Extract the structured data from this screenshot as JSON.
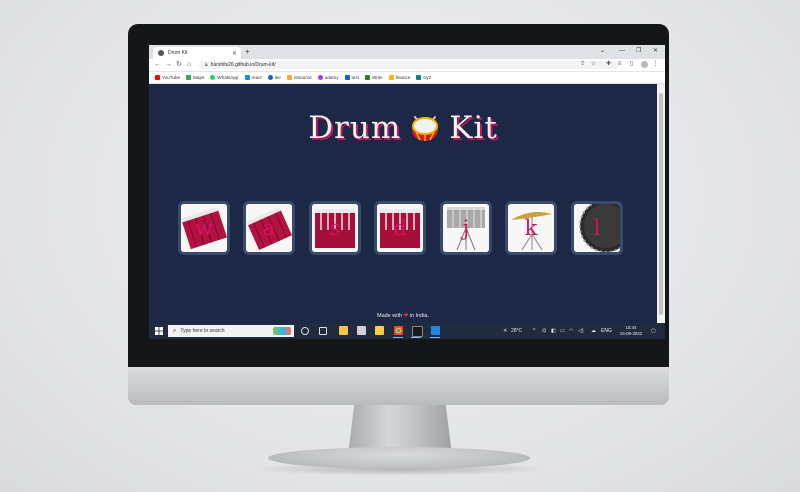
{
  "browser": {
    "tab_title": "Drum Kit",
    "new_tab": "+",
    "url": "harshits26.github.io/Drum-kit/",
    "bookmarks": [
      {
        "label": "YouTube",
        "color": "#ff0000"
      },
      {
        "label": "Maps",
        "color": "#34a853"
      },
      {
        "label": "WhatsApp",
        "color": "#25d366"
      },
      {
        "label": "react",
        "color": "#1e88e5"
      },
      {
        "label": "lee",
        "color": "#1565c0"
      },
      {
        "label": "resource",
        "color": "#f9a825"
      },
      {
        "label": "udemy",
        "color": "#a435f0"
      },
      {
        "label": "test",
        "color": "#1565c0"
      },
      {
        "label": "Write",
        "color": "#2e7d32"
      },
      {
        "label": "finance",
        "color": "#ffb300"
      },
      {
        "label": "try2",
        "color": "#00897b"
      }
    ]
  },
  "page": {
    "title_left": "Drum",
    "title_right": "Kit",
    "keys": [
      {
        "letter": "w",
        "sound": "tom-1"
      },
      {
        "letter": "a",
        "sound": "tom-2"
      },
      {
        "letter": "s",
        "sound": "tom-3"
      },
      {
        "letter": "d",
        "sound": "tom-4"
      },
      {
        "letter": "j",
        "sound": "snare"
      },
      {
        "letter": "k",
        "sound": "crash"
      },
      {
        "letter": "l",
        "sound": "kick-bass"
      }
    ],
    "footer_prefix": "Made with",
    "footer_heart": "❤",
    "footer_suffix": "in India."
  },
  "taskbar": {
    "search_placeholder": "Type here to search",
    "weather": "28°C",
    "language": "ENG",
    "time": "15:44",
    "date": "16-09-2022"
  },
  "colors": {
    "page_bg": "#1d2846",
    "accent": "#d3125f",
    "key_border": "#3a4a6b"
  }
}
